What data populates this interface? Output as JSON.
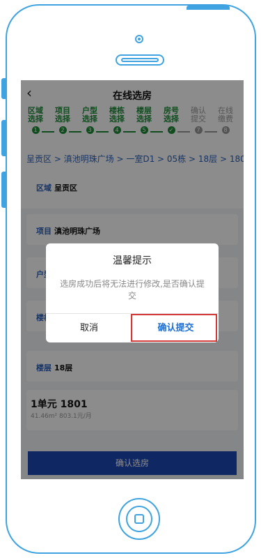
{
  "header": {
    "back_icon": "chevron-left-icon",
    "title": "在线选房"
  },
  "steps": [
    {
      "label": "区域选择",
      "index": "1",
      "status": "done"
    },
    {
      "label": "项目选择",
      "index": "2",
      "status": "done"
    },
    {
      "label": "户型选择",
      "index": "3",
      "status": "done"
    },
    {
      "label": "楼栋选择",
      "index": "4",
      "status": "done"
    },
    {
      "label": "楼层选择",
      "index": "5",
      "status": "done"
    },
    {
      "label": "房号选择",
      "index": "✓",
      "status": "done"
    },
    {
      "label": "确认提交",
      "index": "7",
      "status": "todo"
    },
    {
      "label": "在线缴费",
      "index": "8",
      "status": "todo"
    }
  ],
  "breadcrumb": "呈贡区 > 滇池明珠广场 > 一室D1 > 05栋 > 18层 > 1801",
  "fields": {
    "region": {
      "key": "区域",
      "value": "呈贡区"
    },
    "project": {
      "key": "项目",
      "value": "滇池明珠广场"
    },
    "unit_type": {
      "key": "户型"
    },
    "building": {
      "key": "楼栋"
    },
    "floor": {
      "key": "楼层",
      "value": "18层"
    }
  },
  "unit": {
    "title": "1单元 1801",
    "subtitle": "41.46m² 803.1元/月"
  },
  "confirm_select_button": "确认选房",
  "dialog": {
    "title": "温馨提示",
    "message": "选房成功后将无法进行修改,是否确认提交",
    "cancel": "取消",
    "ok": "确认提交"
  },
  "colors": {
    "frame": "#3ea3e0",
    "step_done": "#1f8a3a",
    "link": "#2b5fb8",
    "primary": "#1d49b6",
    "highlight": "#d23a3a"
  }
}
